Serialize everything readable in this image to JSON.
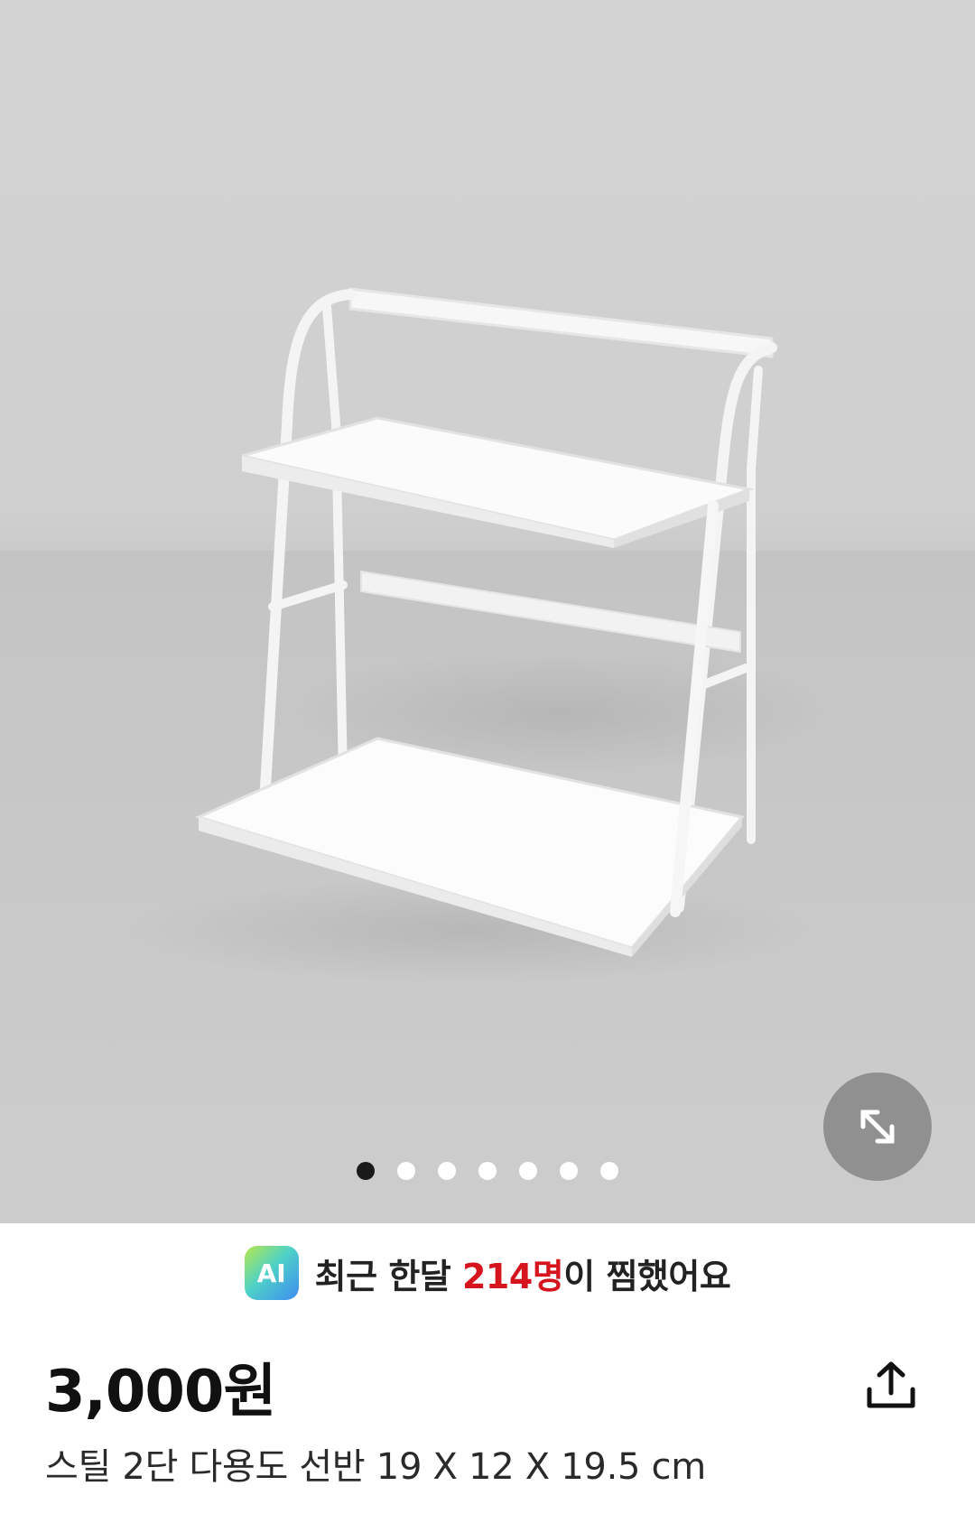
{
  "gallery": {
    "image_alt": "white 2-tier steel shelf",
    "total_images": 7,
    "active_index": 0,
    "expand_icon": "expand-arrows-icon"
  },
  "wish_banner": {
    "badge": "AI",
    "text_before": "최근 한달 ",
    "count": "214명",
    "text_after": "이 찜했어요"
  },
  "product": {
    "price": "3,000원",
    "title": "스틸 2단 다용도 선반 19 X 12 X 19.5 cm",
    "share_icon": "share-upload-icon"
  },
  "colors": {
    "accent_red": "#d6141e",
    "background_gray": "#cfcfcf"
  }
}
